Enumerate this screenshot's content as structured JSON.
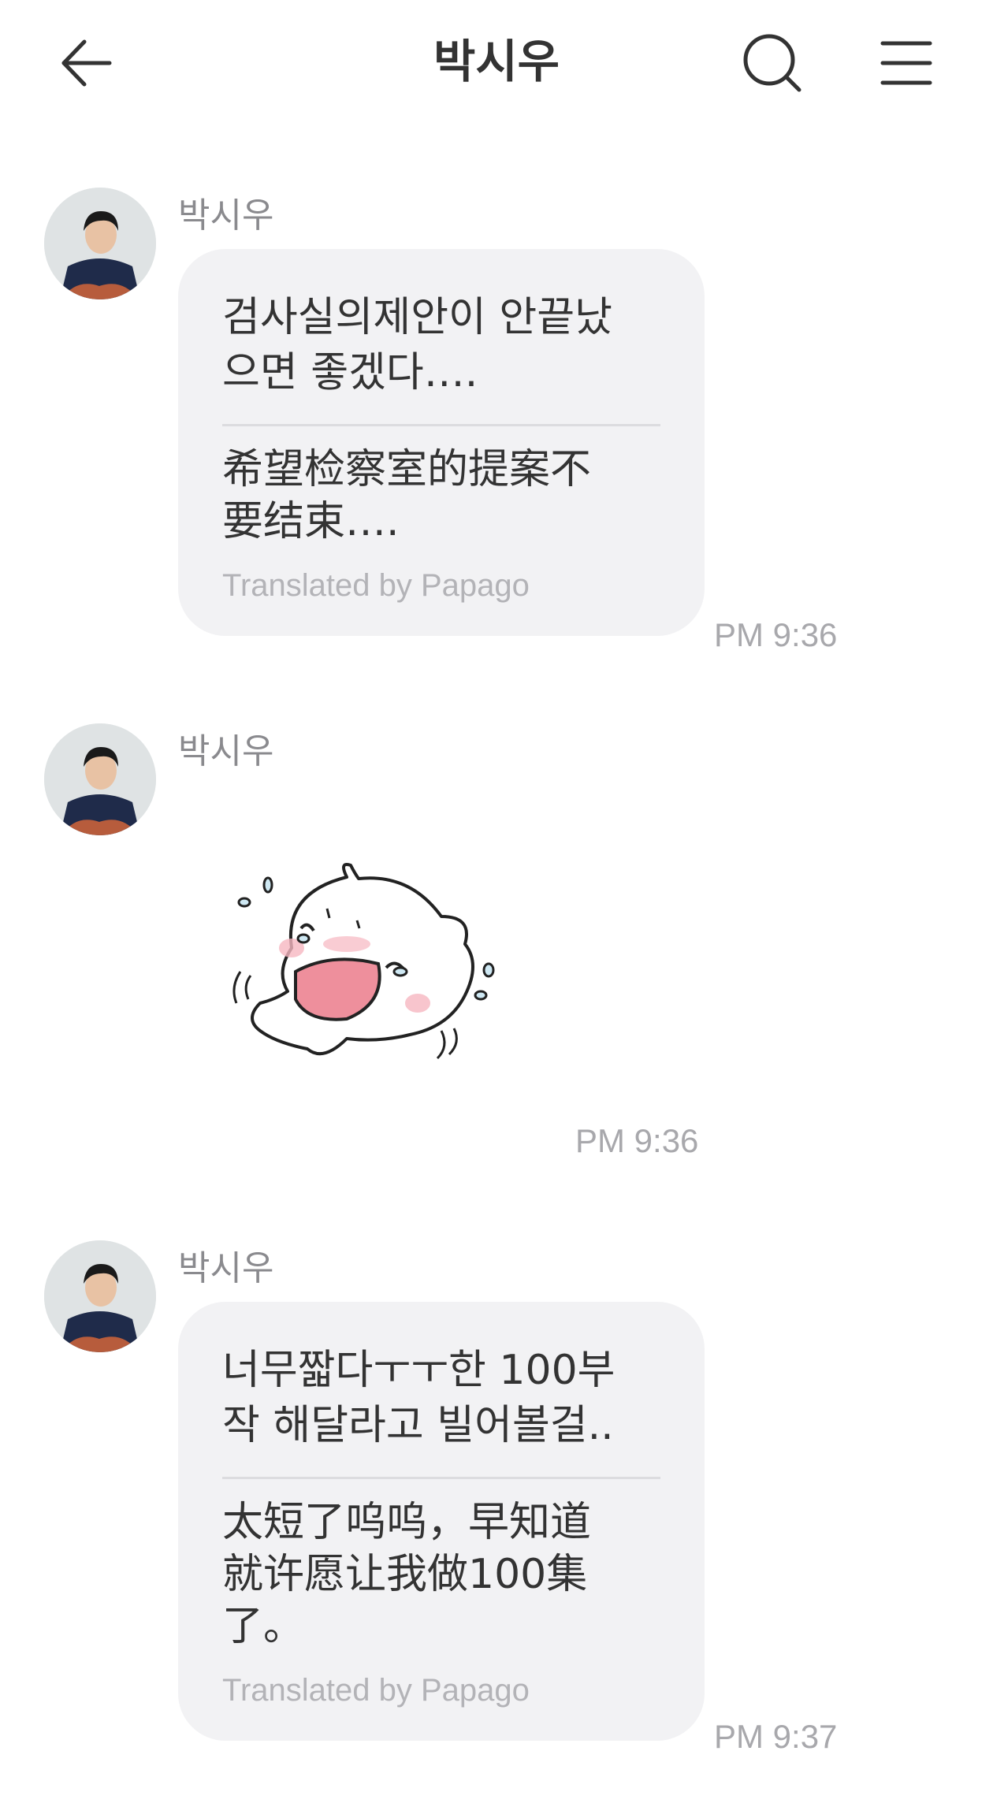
{
  "header": {
    "title": "박시우"
  },
  "messages": [
    {
      "sender": "박시우",
      "original": "검사실의제안이 안끝났\n으면 좋겠다….",
      "translation": "希望检察室的提案不\n要结束….",
      "credit": "Translated by Papago",
      "time": "PM 9:36"
    },
    {
      "sender": "박시우",
      "sticker": "crying-cartoon-sticker",
      "time": "PM 9:36"
    },
    {
      "sender": "박시우",
      "original": "너무짧다ㅜㅜ한 100부\n작 해달라고 빌어볼걸..",
      "translation": "太短了呜呜，早知道\n就许愿让我做100集\n了。",
      "credit": "Translated by Papago",
      "time": "PM 9:37"
    }
  ],
  "colors": {
    "bubble": "#f2f2f4",
    "time": "#a8a8ac",
    "credit": "#b3b3b7",
    "sender": "#8a8a8e",
    "sticker_mouth": "#ee8f9c"
  }
}
